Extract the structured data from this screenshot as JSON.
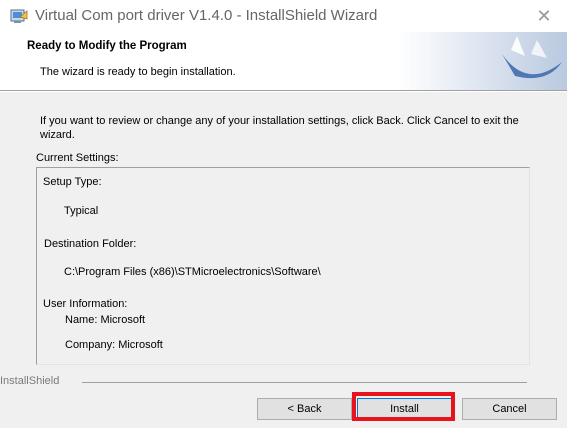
{
  "window": {
    "title": "Virtual Com port driver V1.4.0 - InstallShield Wizard",
    "app_icon": "installer-icon",
    "close_symbol": "✕"
  },
  "header": {
    "title": "Ready to Modify the Program",
    "subtitle": "The wizard is ready to begin installation."
  },
  "body": {
    "intro": "If you want to review or change any of your installation settings, click Back. Click Cancel to exit the wizard.",
    "current_settings_label": "Current Settings:",
    "settings": {
      "setup_type_label": "Setup Type:",
      "setup_type_value": "Typical",
      "destination_label": "Destination Folder:",
      "destination_value": "C:\\Program Files (x86)\\STMicroelectronics\\Software\\",
      "user_info_label": "User Information:",
      "name_line": "Name: Microsoft",
      "company_line": "Company: Microsoft"
    }
  },
  "footer": {
    "brand": "InstallShield",
    "back_label": "< Back",
    "install_label": "Install",
    "cancel_label": "Cancel"
  },
  "colors": {
    "highlight": "#e8141b",
    "dialog_bg": "#f0f0f0",
    "banner_accent": "#5a7fb5"
  }
}
